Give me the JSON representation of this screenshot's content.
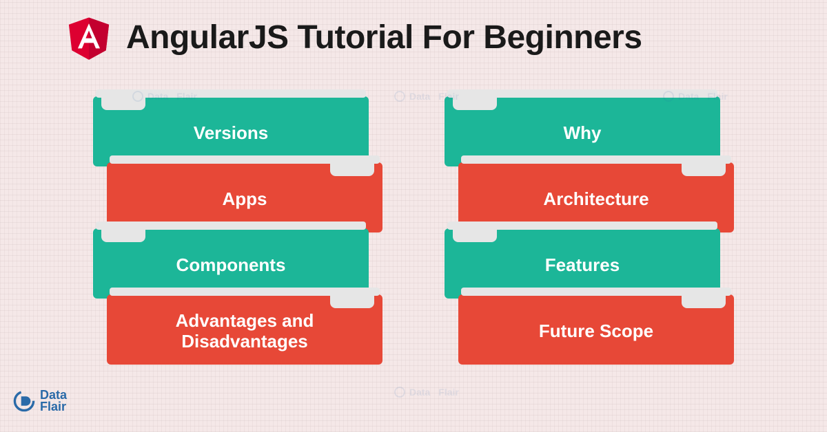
{
  "header": {
    "title": "AngularJS Tutorial  For Beginners",
    "logo_letter": "A"
  },
  "columns": {
    "left": [
      {
        "label": "Versions",
        "color": "teal",
        "notch": "left"
      },
      {
        "label": "Apps",
        "color": "red",
        "notch": "right"
      },
      {
        "label": "Components",
        "color": "teal",
        "notch": "left"
      },
      {
        "label": "Advantages and\nDisadvantages",
        "color": "red",
        "notch": "right"
      }
    ],
    "right": [
      {
        "label": "Why",
        "color": "teal",
        "notch": "left"
      },
      {
        "label": "Architecture",
        "color": "red",
        "notch": "right"
      },
      {
        "label": "Features",
        "color": "teal",
        "notch": "left"
      },
      {
        "label": "Future Scope",
        "color": "red",
        "notch": "right"
      }
    ]
  },
  "brand": {
    "line1": "Data",
    "line2": "Flair"
  },
  "colors": {
    "teal": "#1cb698",
    "red": "#e74837",
    "angular_red": "#dd0031",
    "angular_dark": "#c3002f"
  }
}
